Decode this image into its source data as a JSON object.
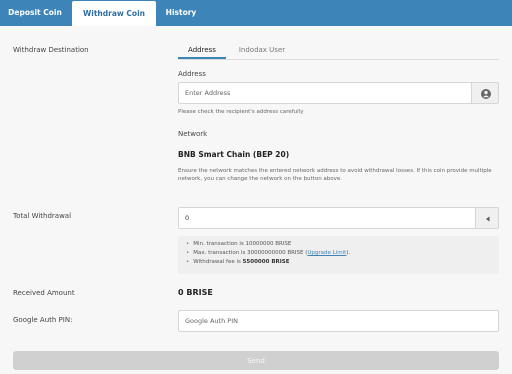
{
  "tabs": [
    {
      "label": "Deposit Coin"
    },
    {
      "label": "Withdraw Coin"
    },
    {
      "label": "History"
    }
  ],
  "destination": {
    "label": "Withdraw Destination",
    "subtabs": [
      {
        "label": "Address"
      },
      {
        "label": "Indodax User"
      }
    ],
    "address_label": "Address",
    "address_placeholder": "Enter Address",
    "address_hint": "Please check the recipient's address carefully",
    "network_label": "Network",
    "network_value": "BNB Smart Chain (BEP 20)",
    "network_note": "Ensure the network matches the entered network address to avoid withdrawal losses. If this coin provide multiple network, you can change the network on the button above."
  },
  "withdrawal": {
    "label": "Total Withdrawal",
    "value": "0",
    "min_text": "Min. transaction is 10000000 BRISE",
    "max_text": "Max. transaction is 30000000000 BRISE (",
    "max_link": "Upgrade Limit",
    "max_suffix": ").",
    "fee_prefix": "Withdrawal fee is ",
    "fee_value": "5500000 BRISE"
  },
  "received": {
    "label": "Received Amount",
    "value": "0 BRISE"
  },
  "auth": {
    "label": "Google Auth PIN:",
    "placeholder": "Google Auth PIN"
  },
  "send_label": "Send",
  "colors": {
    "accent": "#3d85b8",
    "panel": "#f7f7f7",
    "disabled_button": "#d0d0d0"
  },
  "icons": {
    "address_book": "user-circle-icon",
    "network_toggle": "caret-left-icon"
  }
}
